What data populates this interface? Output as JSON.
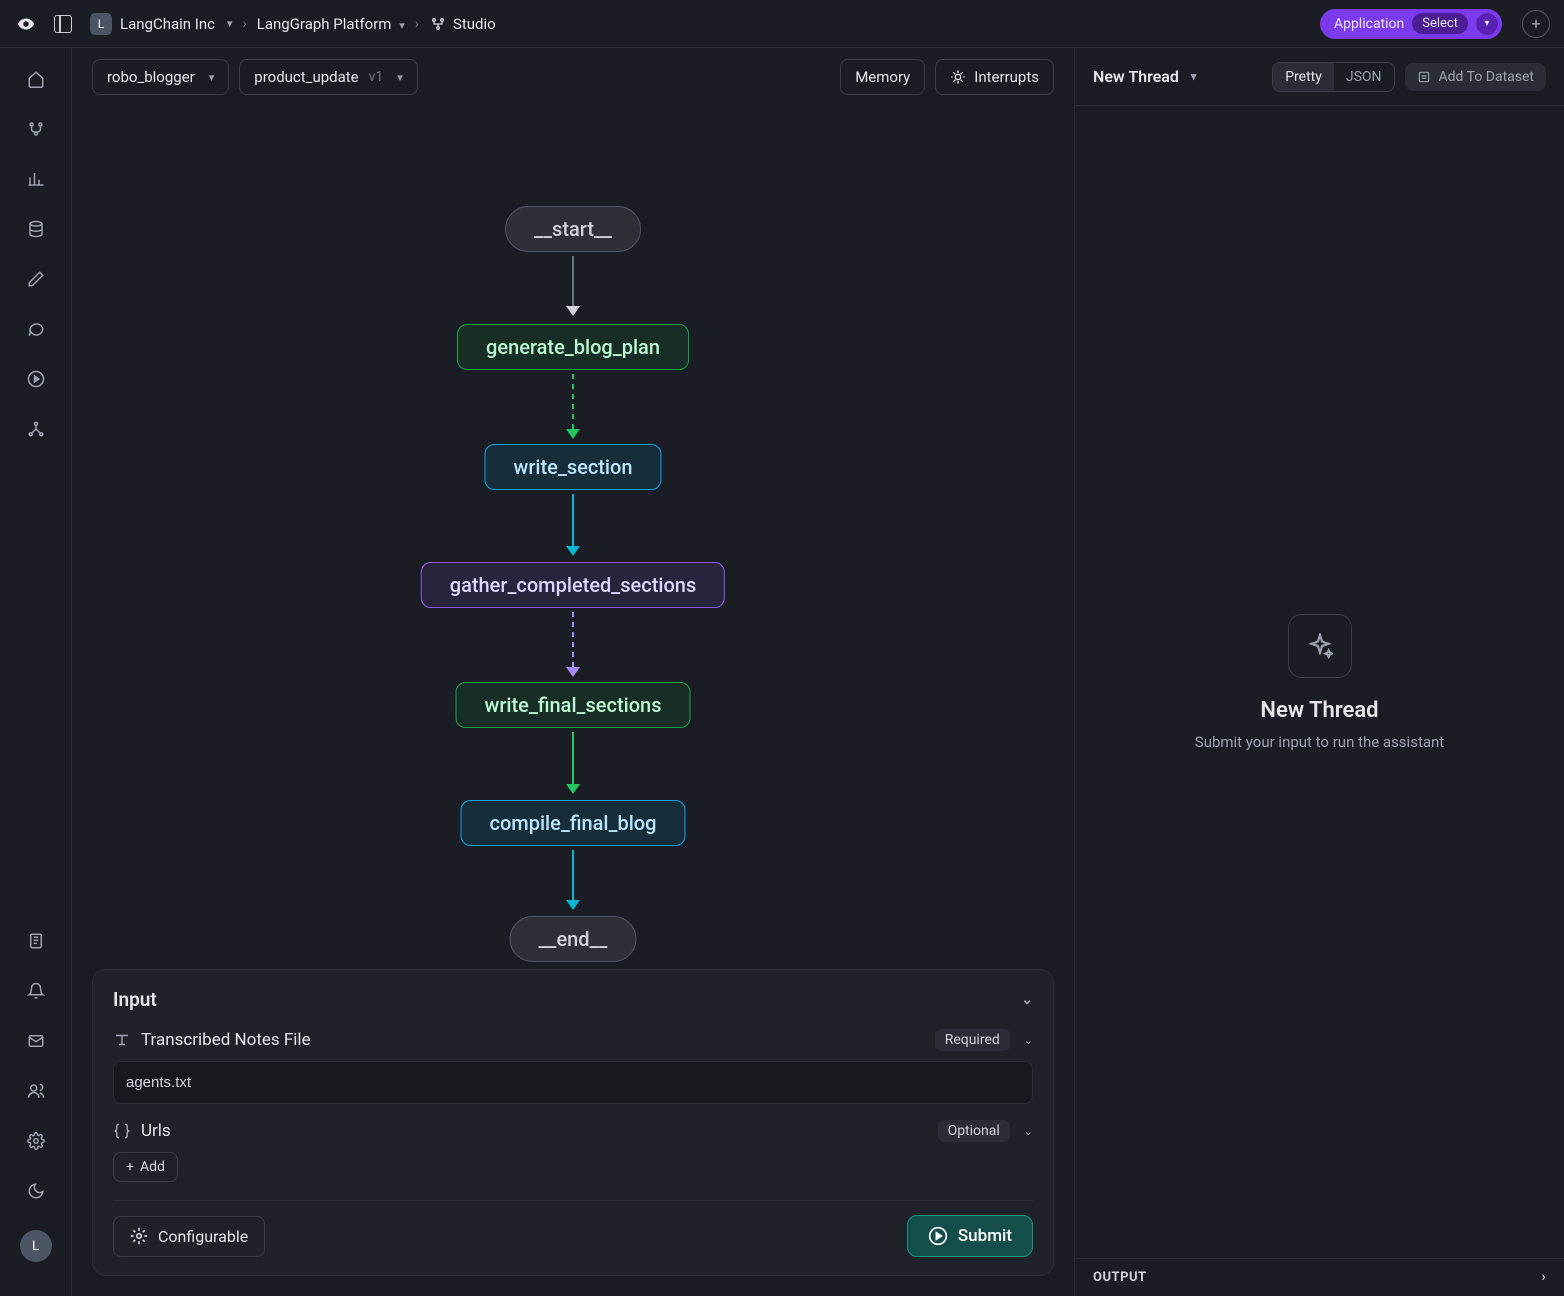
{
  "breadcrumb": {
    "org_initial": "L",
    "org": "LangChain Inc",
    "platform": "LangGraph Platform",
    "page": "Studio"
  },
  "header": {
    "app_pill_label": "Application",
    "app_pill_select": "Select",
    "add_label": "+"
  },
  "graph_toolbar": {
    "graph_name": "robo_blogger",
    "assistant_name": "product_update",
    "assistant_version": "v1",
    "memory_btn": "Memory",
    "interrupts_btn": "Interrupts"
  },
  "graph": {
    "nodes": [
      {
        "label": "__start__"
      },
      {
        "label": "generate_blog_plan"
      },
      {
        "label": "write_section"
      },
      {
        "label": "gather_completed_sections"
      },
      {
        "label": "write_final_sections"
      },
      {
        "label": "compile_final_blog"
      },
      {
        "label": "__end__"
      }
    ]
  },
  "input_panel": {
    "title": "Input",
    "fields": [
      {
        "label": "Transcribed Notes File",
        "badge": "Required",
        "value": "agents.txt"
      },
      {
        "label": "Urls",
        "badge": "Optional",
        "add_label": "Add"
      }
    ],
    "configurable_btn": "Configurable",
    "submit_btn": "Submit"
  },
  "thread": {
    "title": "New Thread",
    "pretty": "Pretty",
    "json": "JSON",
    "dataset_btn": "Add To Dataset",
    "empty_title": "New Thread",
    "empty_sub": "Submit your input to run the assistant",
    "output_label": "OUTPUT"
  },
  "avatar_initial": "L"
}
